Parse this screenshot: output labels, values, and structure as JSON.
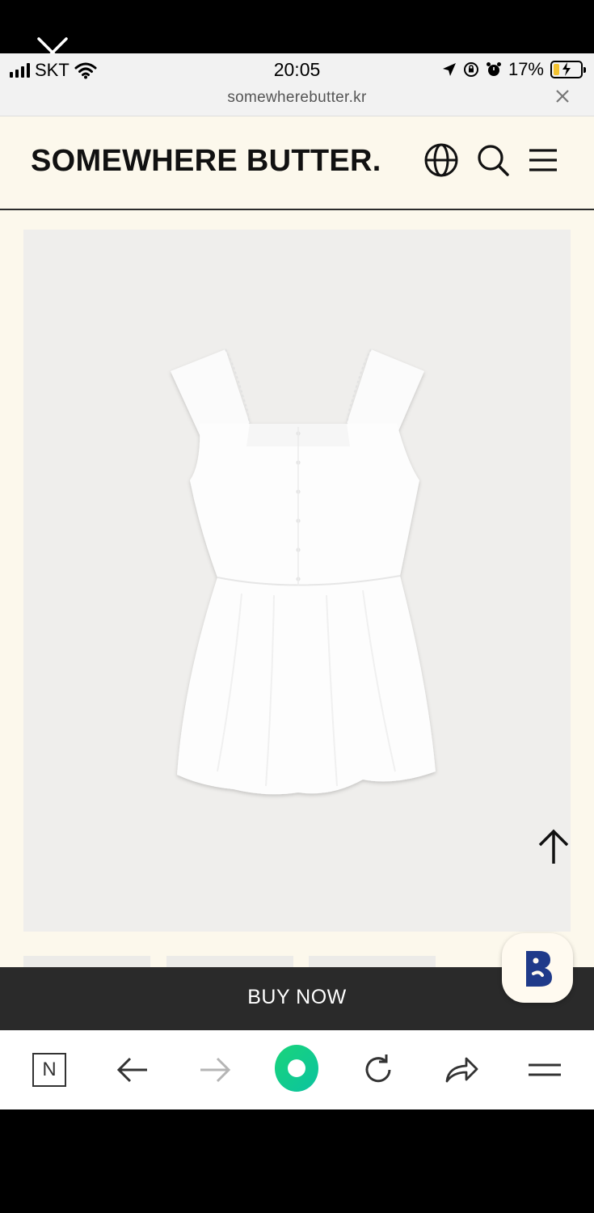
{
  "status_bar": {
    "carrier": "SKT",
    "time": "20:05",
    "battery_percent": "17%"
  },
  "url_bar": {
    "url": "somewherebutter.kr"
  },
  "site": {
    "brand": "SOMEWHERE BUTTER.",
    "buy_label": "BUY NOW"
  },
  "colors": {
    "site_background": "#fcf8ec",
    "buy_bar": "#2a2a2a",
    "product_background": "#efeeec",
    "chat_logo": "#1f3a8a",
    "toolbar_green": "#19d47a"
  },
  "icons": {
    "overlay_close": "close-icon",
    "header": [
      "globe-icon",
      "search-icon",
      "menu-icon"
    ],
    "scroll_top": "arrow-up-icon",
    "chat": "b-logo-icon",
    "toolbar": [
      "naver-n-icon",
      "back-arrow-icon",
      "forward-arrow-icon",
      "green-circle-icon",
      "refresh-icon",
      "share-icon",
      "menu-icon"
    ]
  }
}
